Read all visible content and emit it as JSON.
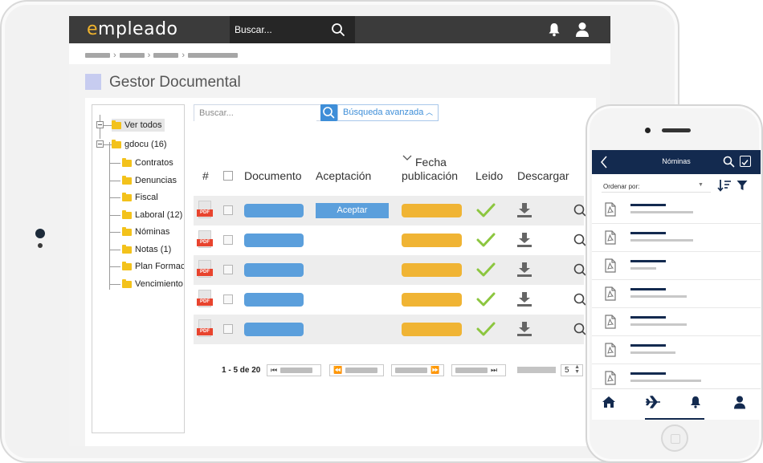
{
  "app": {
    "logo": "empleado",
    "search_placeholder": "Buscar..."
  },
  "page": {
    "title": "Gestor Documental"
  },
  "tree": {
    "root_label": "Ver todos",
    "group_label": "gdocu (16)",
    "children": [
      "Contratos",
      "Denuncias",
      "Fiscal",
      "Laboral (12)",
      "Nóminas",
      "Notas (1)",
      "Plan Formac",
      "Vencimiento"
    ]
  },
  "grid": {
    "search_placeholder": "Buscar...",
    "advanced_search_label": "Búsqueda avanzada",
    "columns": {
      "num": "#",
      "document": "Documento",
      "acceptance": "Aceptación",
      "date_line1": "Fecha",
      "date_line2": "publicación",
      "read": "Leido",
      "download": "Descargar"
    },
    "pdf_tag": "PDF",
    "accept_label": "Aceptar",
    "rows": [
      {
        "has_accept": true
      },
      {
        "has_accept": false
      },
      {
        "has_accept": false
      },
      {
        "has_accept": false
      },
      {
        "has_accept": false
      }
    ],
    "pager": {
      "summary": "1 - 5 de 20",
      "page_size": "5"
    }
  },
  "phone": {
    "title": "Nóminas",
    "sort_label": "Ordenar por:",
    "items_count_visible": 7
  },
  "colors": {
    "header_dark": "#3b3b3b",
    "brand_accent": "#f0b32c",
    "doc_blue": "#5b9fdc",
    "date_orange": "#f0b434",
    "check_green": "#8cc63f",
    "phone_navy": "#132a4f"
  }
}
